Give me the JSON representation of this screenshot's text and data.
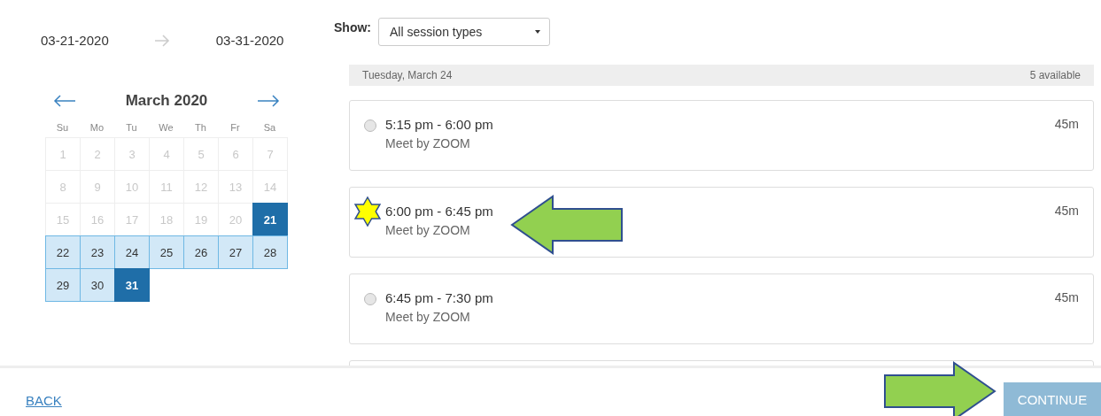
{
  "range": {
    "start": "03-21-2020",
    "end": "03-31-2020"
  },
  "calendar": {
    "title": "March 2020",
    "weekdays": [
      "Su",
      "Mo",
      "Tu",
      "We",
      "Th",
      "Fr",
      "Sa"
    ],
    "days": [
      {
        "label": "1",
        "disabled": true,
        "selected": false,
        "in_range": false
      },
      {
        "label": "2",
        "disabled": true,
        "selected": false,
        "in_range": false
      },
      {
        "label": "3",
        "disabled": true,
        "selected": false,
        "in_range": false
      },
      {
        "label": "4",
        "disabled": true,
        "selected": false,
        "in_range": false
      },
      {
        "label": "5",
        "disabled": true,
        "selected": false,
        "in_range": false
      },
      {
        "label": "6",
        "disabled": true,
        "selected": false,
        "in_range": false
      },
      {
        "label": "7",
        "disabled": true,
        "selected": false,
        "in_range": false
      },
      {
        "label": "8",
        "disabled": true,
        "selected": false,
        "in_range": false
      },
      {
        "label": "9",
        "disabled": true,
        "selected": false,
        "in_range": false
      },
      {
        "label": "10",
        "disabled": true,
        "selected": false,
        "in_range": false
      },
      {
        "label": "11",
        "disabled": true,
        "selected": false,
        "in_range": false
      },
      {
        "label": "12",
        "disabled": true,
        "selected": false,
        "in_range": false
      },
      {
        "label": "13",
        "disabled": true,
        "selected": false,
        "in_range": false
      },
      {
        "label": "14",
        "disabled": true,
        "selected": false,
        "in_range": false
      },
      {
        "label": "15",
        "disabled": true,
        "selected": false,
        "in_range": false
      },
      {
        "label": "16",
        "disabled": true,
        "selected": false,
        "in_range": false
      },
      {
        "label": "17",
        "disabled": true,
        "selected": false,
        "in_range": false
      },
      {
        "label": "18",
        "disabled": true,
        "selected": false,
        "in_range": false
      },
      {
        "label": "19",
        "disabled": true,
        "selected": false,
        "in_range": false
      },
      {
        "label": "20",
        "disabled": true,
        "selected": false,
        "in_range": false
      },
      {
        "label": "21",
        "disabled": false,
        "selected": true,
        "in_range": false
      },
      {
        "label": "22",
        "disabled": false,
        "selected": false,
        "in_range": true
      },
      {
        "label": "23",
        "disabled": false,
        "selected": false,
        "in_range": true
      },
      {
        "label": "24",
        "disabled": false,
        "selected": false,
        "in_range": true
      },
      {
        "label": "25",
        "disabled": false,
        "selected": false,
        "in_range": true
      },
      {
        "label": "26",
        "disabled": false,
        "selected": false,
        "in_range": true
      },
      {
        "label": "27",
        "disabled": false,
        "selected": false,
        "in_range": true
      },
      {
        "label": "28",
        "disabled": false,
        "selected": false,
        "in_range": true
      },
      {
        "label": "29",
        "disabled": false,
        "selected": false,
        "in_range": true
      },
      {
        "label": "30",
        "disabled": false,
        "selected": false,
        "in_range": true
      },
      {
        "label": "31",
        "disabled": false,
        "selected": true,
        "in_range": false
      }
    ]
  },
  "filter": {
    "label": "Show:",
    "value": "All session types"
  },
  "day_header": {
    "date": "Tuesday, March 24",
    "count": "5 available"
  },
  "slots": [
    {
      "time": "5:15 pm - 6:00 pm",
      "location": "Meet by ZOOM",
      "duration": "45m",
      "selected": false,
      "starred": false,
      "pointed": false
    },
    {
      "time": "6:00 pm - 6:45 pm",
      "location": "Meet by ZOOM",
      "duration": "45m",
      "selected": false,
      "starred": true,
      "pointed": true
    },
    {
      "time": "6:45 pm - 7:30 pm",
      "location": "Meet by ZOOM",
      "duration": "45m",
      "selected": false,
      "starred": false,
      "pointed": false
    }
  ],
  "footer": {
    "back": "BACK",
    "continue": "CONTINUE",
    "continue_disabled": true,
    "continue_pointed": true
  }
}
